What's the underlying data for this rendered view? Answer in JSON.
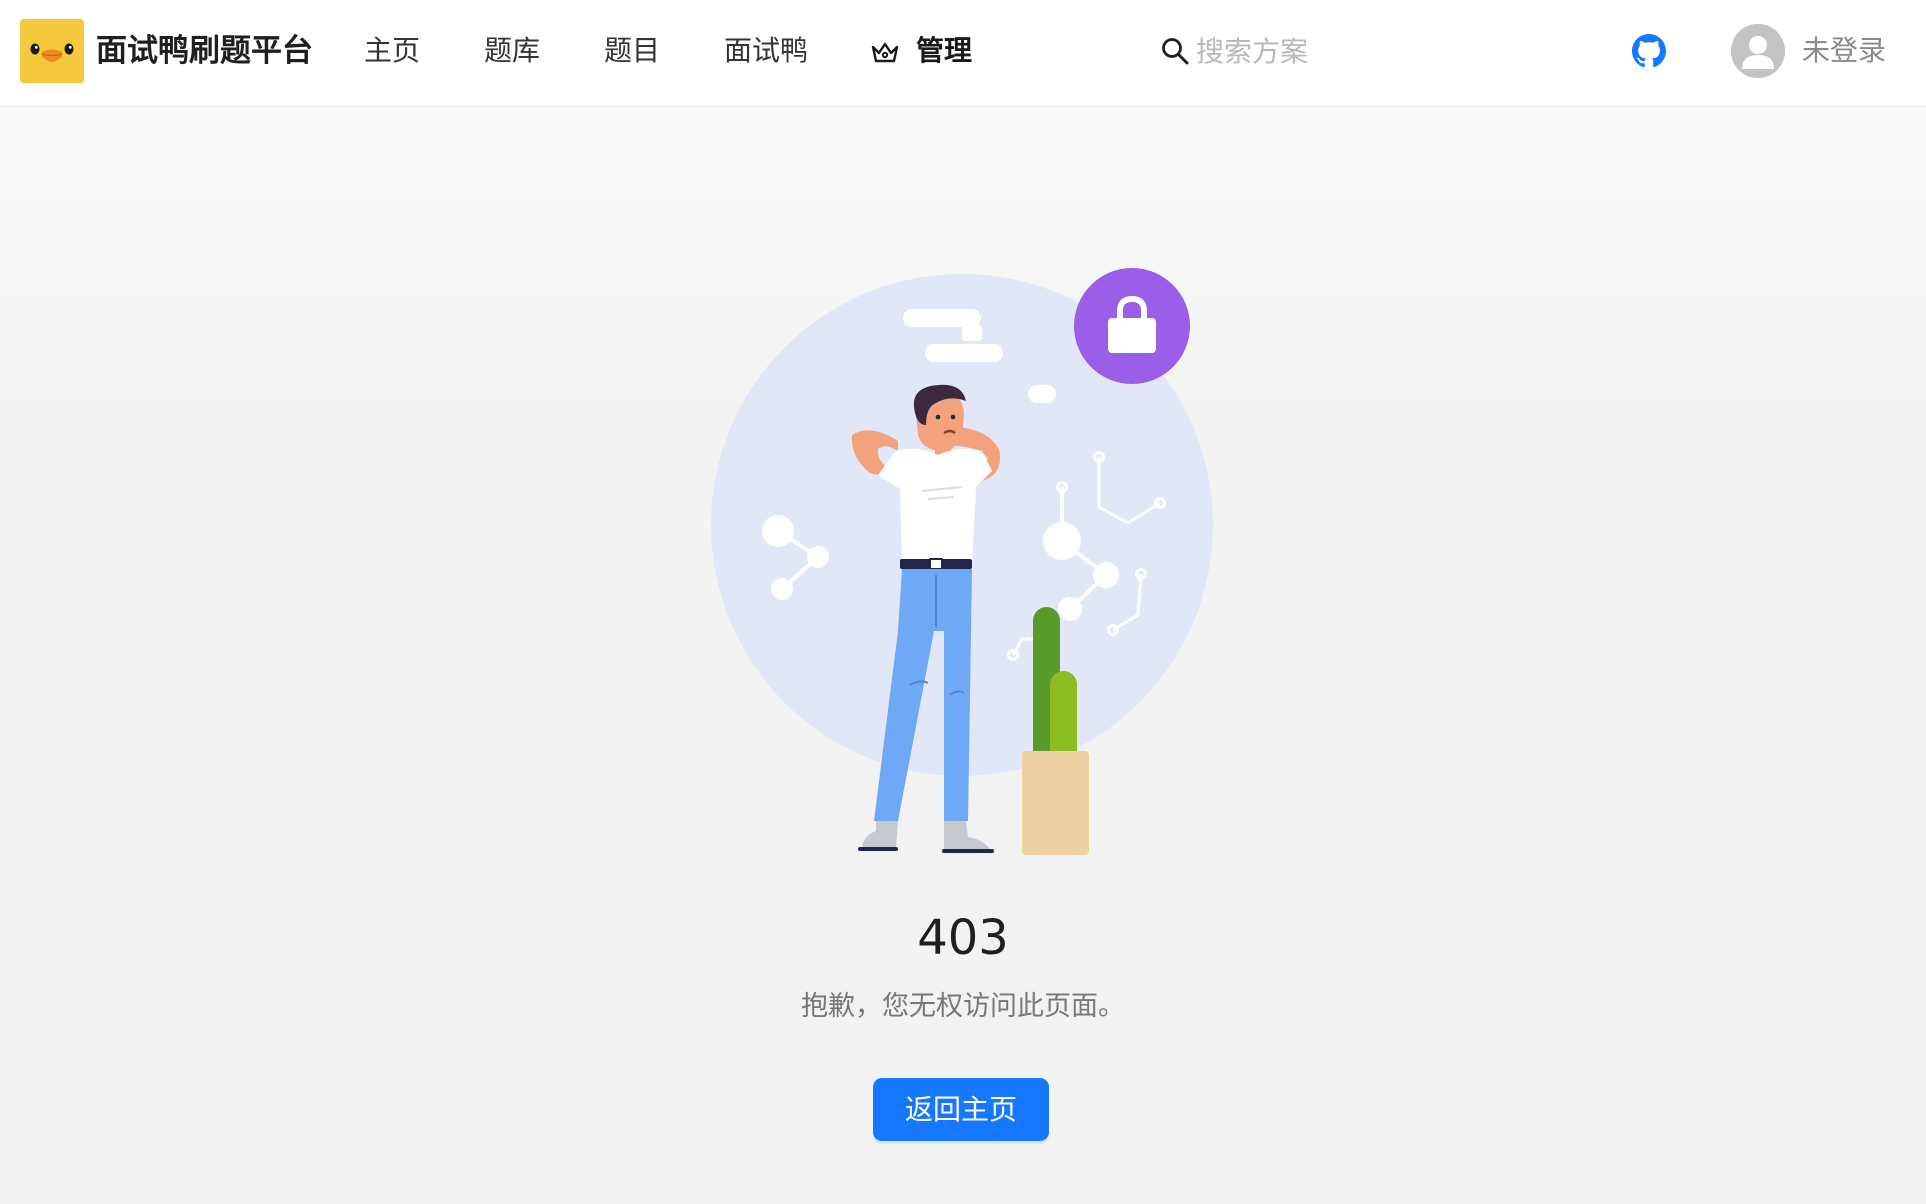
{
  "header": {
    "brand": "面试鸭刷题平台",
    "nav": [
      {
        "label": "主页"
      },
      {
        "label": "题库"
      },
      {
        "label": "题目"
      },
      {
        "label": "面试鸭"
      },
      {
        "label": "管理",
        "icon": "crown-icon"
      }
    ],
    "search": {
      "placeholder": "搜索方案",
      "value": ""
    },
    "github_icon": "github-icon",
    "user": {
      "avatar_icon": "user-avatar-icon",
      "login_text": "未登录"
    }
  },
  "result": {
    "status": "403",
    "message": "抱歉，您无权访问此页面。",
    "button_label": "返回主页"
  },
  "colors": {
    "primary": "#1677ff",
    "github": "#1677ff",
    "logo_bg": "#f5c93c",
    "lock_badge": "#9b5ee8",
    "illustration_circle": "#e1e7f6"
  }
}
